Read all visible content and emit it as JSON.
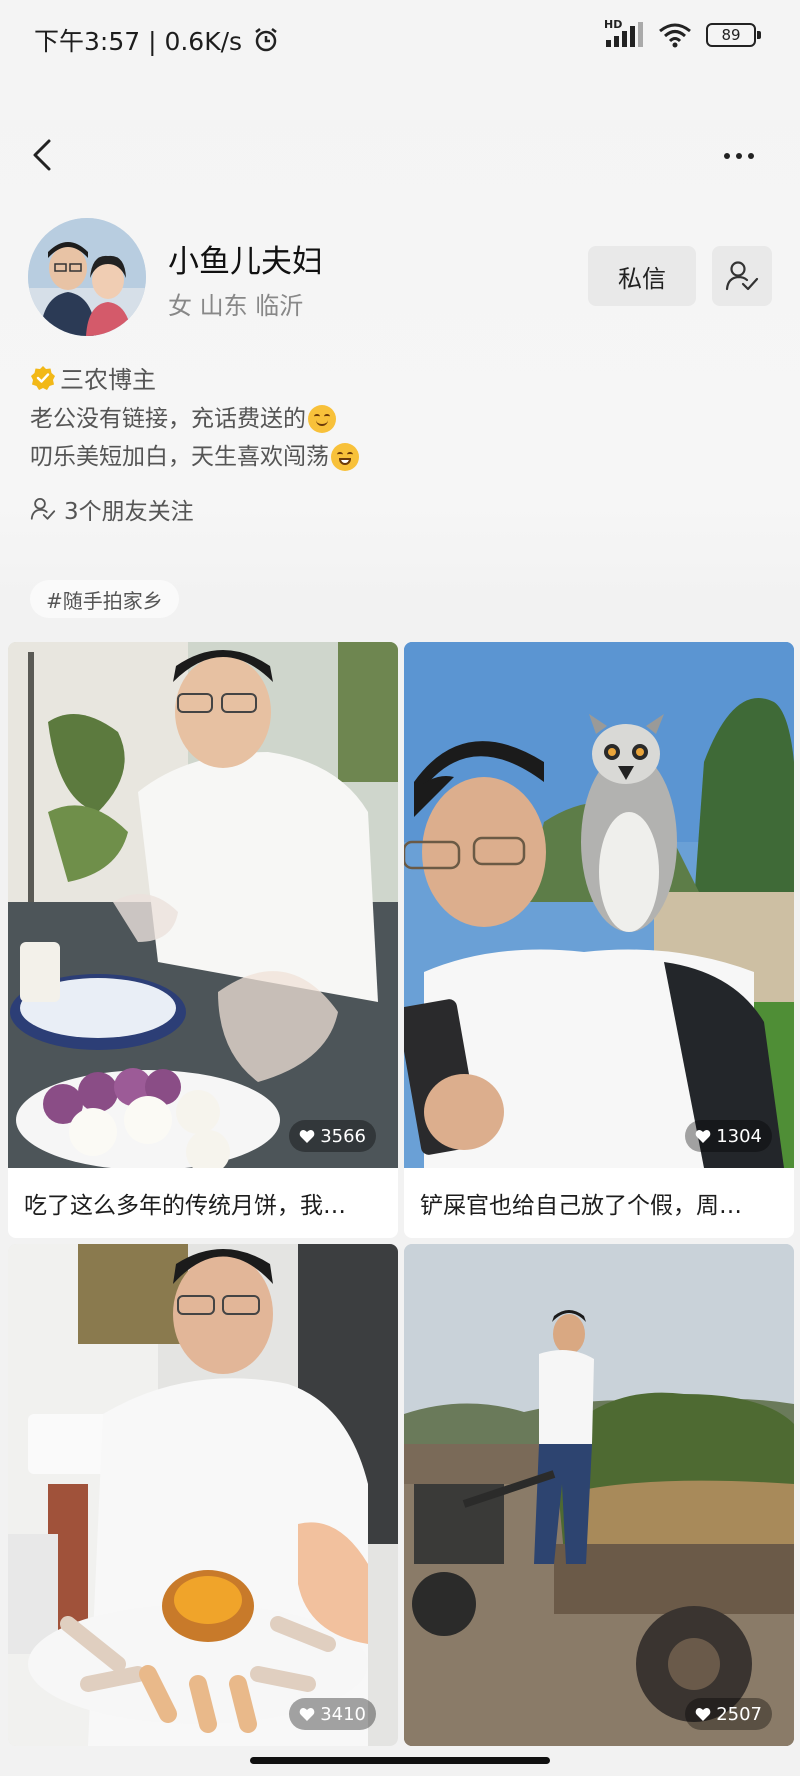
{
  "status_bar": {
    "time_speed": "下午3:57 | 0.6K/s",
    "network": "HD",
    "battery": "89"
  },
  "profile": {
    "name": "小鱼儿夫妇",
    "location": "女 山东 临沂",
    "message_button": "私信",
    "badge": "三农博主",
    "bio_line1": "老公没有链接，充话费送的",
    "bio_line2": "叨乐美短加白，天生喜欢闯荡",
    "friends_following": "3个朋友关注"
  },
  "tag": "#随手拍家乡",
  "videos": [
    {
      "caption": "吃了这么多年的传统月饼，我…",
      "likes": "3566"
    },
    {
      "caption": "铲屎官也给自己放了个假，周…",
      "likes": "1304"
    },
    {
      "caption": "",
      "likes": "3410"
    },
    {
      "caption": "",
      "likes": "2507"
    }
  ],
  "colors": {
    "background": "#f2f2f2",
    "verified_badge": "#f2b817",
    "button_bg": "#e9e9e9"
  }
}
